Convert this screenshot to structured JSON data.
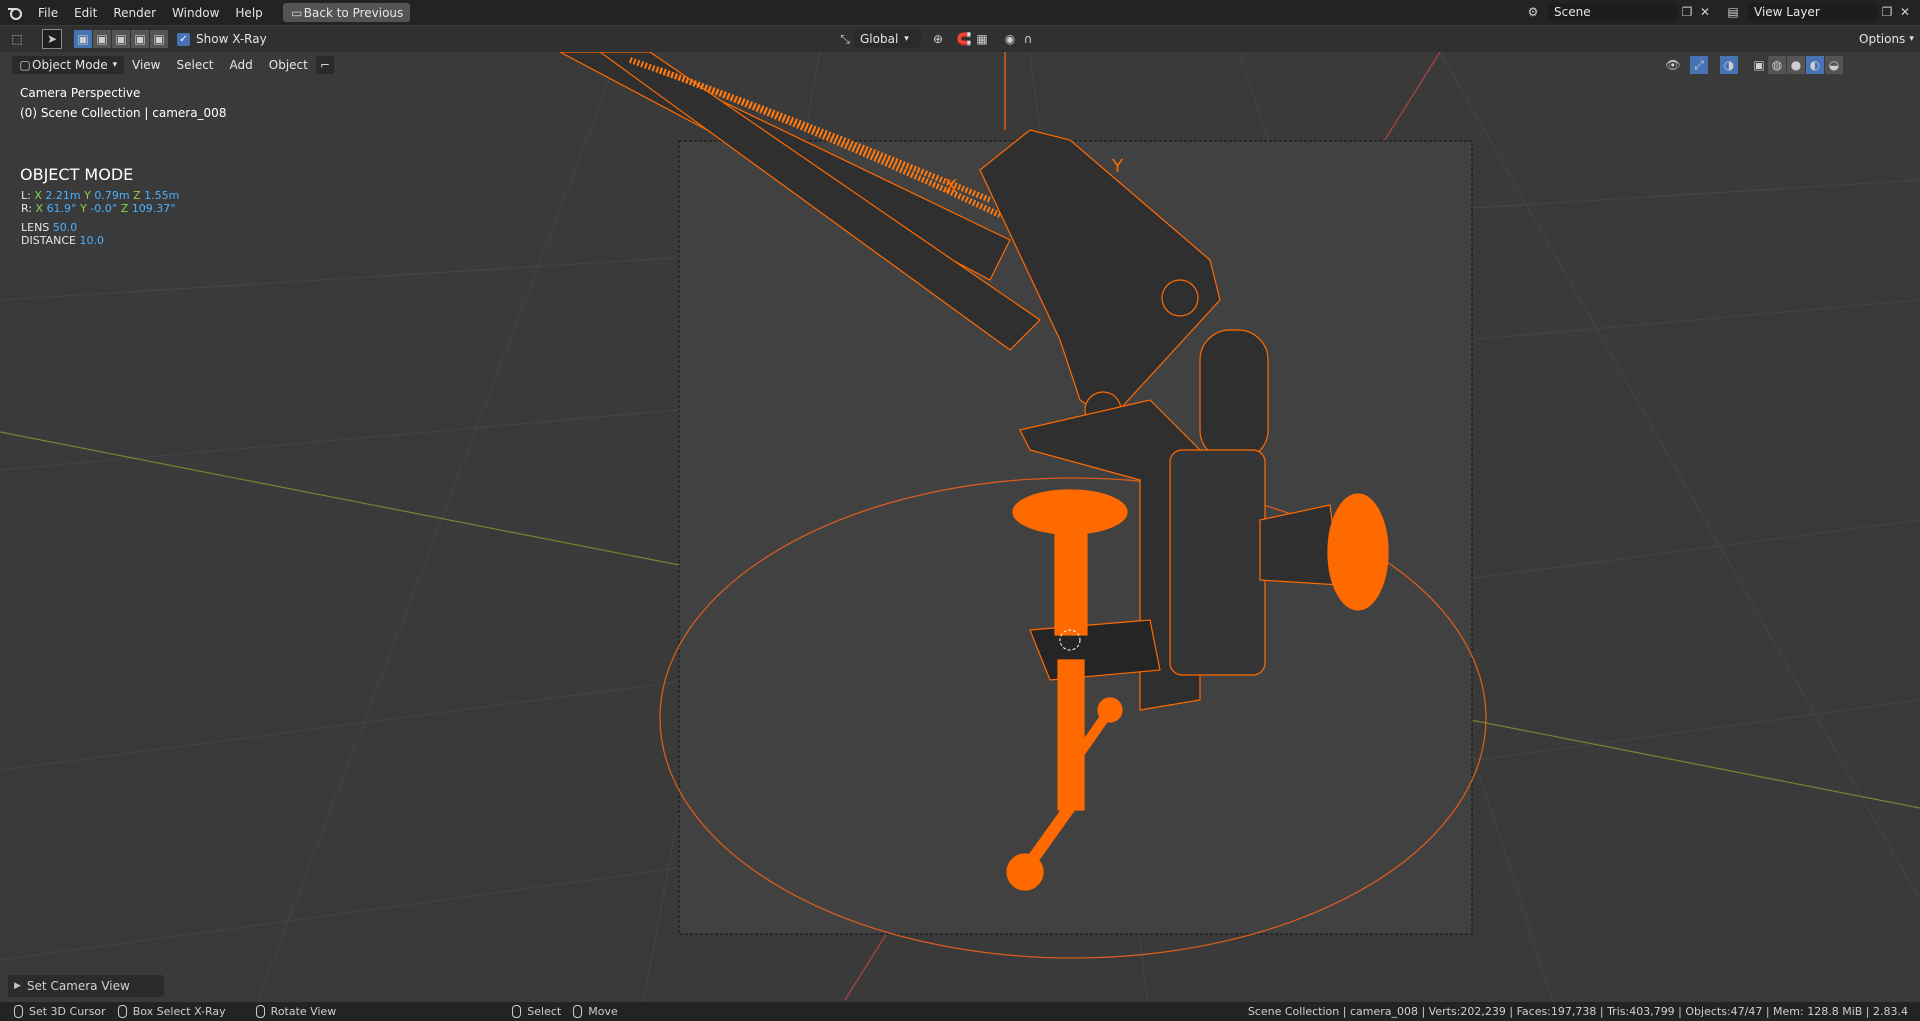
{
  "menubar": {
    "items": [
      "File",
      "Edit",
      "Render",
      "Window",
      "Help"
    ],
    "back_button": "Back to Previous",
    "scene_name": "Scene",
    "view_layer": "View Layer"
  },
  "toolbar": {
    "show_xray_label": "Show X-Ray",
    "show_xray_checked": true,
    "orientation": "Global",
    "options_label": "Options"
  },
  "viewport_header": {
    "mode": "Object Mode",
    "menus": [
      "View",
      "Select",
      "Add",
      "Object"
    ]
  },
  "overlay": {
    "perspective": "Camera Perspective",
    "collection": "(0) Scene Collection | camera_008",
    "mode_title": "OBJECT MODE",
    "location": {
      "label": "L:",
      "x": "2.21m",
      "y": "0.79m",
      "z": "1.55m"
    },
    "rotation": {
      "label": "R:",
      "x": "61.9°",
      "y": "-0.0°",
      "z": "109.37°"
    },
    "lens_label": "LENS",
    "lens_value": "50.0",
    "distance_label": "DISTANCE",
    "distance_value": "10.0",
    "axis_x": "X",
    "axis_y": "Y",
    "axis_z": "Z"
  },
  "operator_panel": {
    "label": "Set Camera View"
  },
  "statusbar": {
    "left_hint": "Set 3D Cursor",
    "middle_hint": "Box Select X-Ray",
    "right_hint": "Rotate View",
    "select_hint": "Select",
    "move_hint": "Move",
    "info": "Scene Collection | camera_008 | Verts:202,239 | Faces:197,738 | Tris:403,799 | Objects:47/47 | Mem: 128.8 MiB | 2.83.4"
  },
  "colors": {
    "accent_blue": "#4772b3",
    "selection_orange": "#ff6a00",
    "value_blue": "#49b2ff"
  }
}
